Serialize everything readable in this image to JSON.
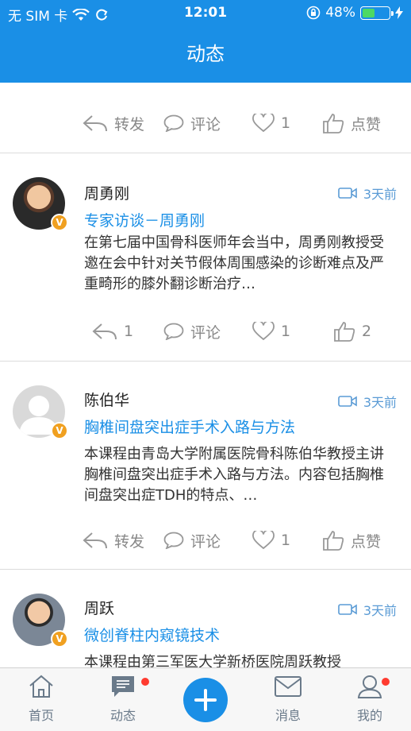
{
  "status_bar": {
    "carrier": "无 SIM 卡",
    "time": "12:01",
    "battery": "48%",
    "battery_level": 0.48
  },
  "nav": {
    "title": "动态"
  },
  "top_actions": {
    "forward": "转发",
    "comment": "评论",
    "likes": "1",
    "praise": "点赞"
  },
  "posts": [
    {
      "name": "周勇刚",
      "time": "3天前",
      "title": "专家访谈－周勇刚",
      "body": "在第七届中国骨科医师年会当中，周勇刚教授受邀在会中针对关节假体周围感染的诊断难点及严重畸形的膝外翻诊断治疗…",
      "actions": {
        "forward": "1",
        "comment": "评论",
        "likes": "1",
        "praise": "2"
      }
    },
    {
      "name": "陈伯华",
      "time": "3天前",
      "title": "胸椎间盘突出症手术入路与方法",
      "body": "本课程由青岛大学附属医院骨科陈伯华教授主讲胸椎间盘突出症手术入路与方法。内容包括胸椎间盘突出症TDH的特点、…",
      "actions": {
        "forward": "转发",
        "comment": "评论",
        "likes": "1",
        "praise": "点赞"
      }
    },
    {
      "name": "周跃",
      "time": "3天前",
      "title": "微创脊柱内窥镜技术",
      "body": "本课程由第三军医大学新桥医院周跃教授"
    }
  ],
  "tabbar": {
    "home": "首页",
    "feed": "动态",
    "messages": "消息",
    "mine": "我的"
  },
  "colors": {
    "accent": "#1a8fe6",
    "badge": "#ff3b30",
    "verified": "#f0a020"
  }
}
